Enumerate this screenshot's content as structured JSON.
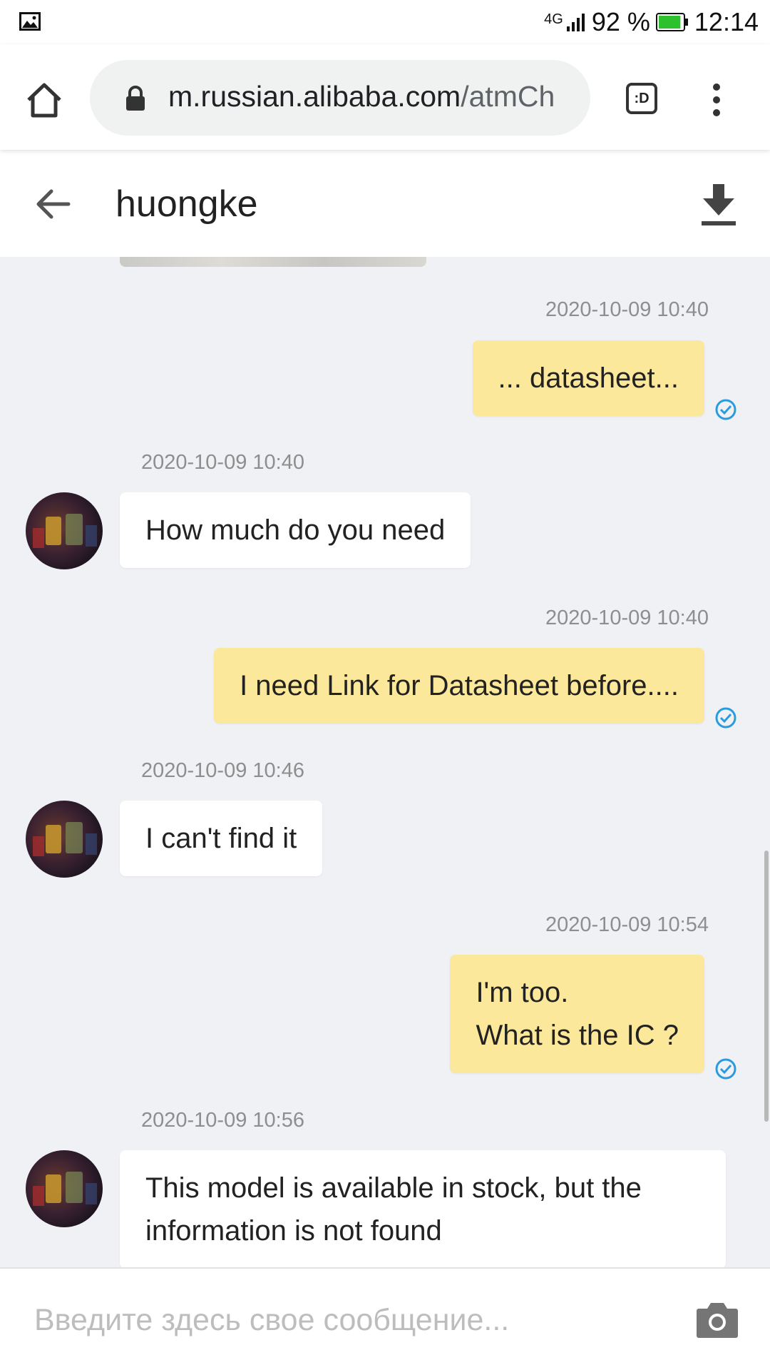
{
  "status_bar": {
    "network": "4G",
    "battery_percent": "92 %",
    "time": "12:14",
    "battery_level": 0.92
  },
  "browser": {
    "url_host": "m.russian.alibaba.com",
    "url_path": "/atmCh",
    "tab_icon_label": ":D",
    "icons": [
      "home-icon",
      "lock-icon",
      "tab-switcher-icon",
      "more-vert-icon"
    ]
  },
  "header": {
    "contact_name": "huongke",
    "icons": [
      "back-arrow-icon",
      "download-icon"
    ]
  },
  "messages": [
    {
      "direction": "out",
      "timestamp": "2020-10-09 10:40",
      "lines": [
        "... datasheet..."
      ],
      "read": true
    },
    {
      "direction": "in",
      "timestamp": "2020-10-09 10:40",
      "lines": [
        "How much do you need"
      ]
    },
    {
      "direction": "out",
      "timestamp": "2020-10-09 10:40",
      "lines": [
        "I need Link for Datasheet before...."
      ],
      "read": true
    },
    {
      "direction": "in",
      "timestamp": "2020-10-09 10:46",
      "lines": [
        "I can't find it"
      ]
    },
    {
      "direction": "out",
      "timestamp": "2020-10-09 10:54",
      "lines": [
        "I'm too.",
        "What is the IC ?"
      ],
      "read": true
    },
    {
      "direction": "in",
      "timestamp": "2020-10-09 10:56",
      "lines": [
        "This model is available in stock, but the",
        "information is not found"
      ]
    }
  ],
  "input": {
    "placeholder": "Введите здесь свое сообщение...",
    "value": "",
    "icons": [
      "camera-icon"
    ]
  },
  "colors": {
    "outgoing_bubble": "#fce89a",
    "incoming_bubble": "#ffffff",
    "chat_background": "#f0f1f5",
    "read_check": "#2b9be0"
  }
}
